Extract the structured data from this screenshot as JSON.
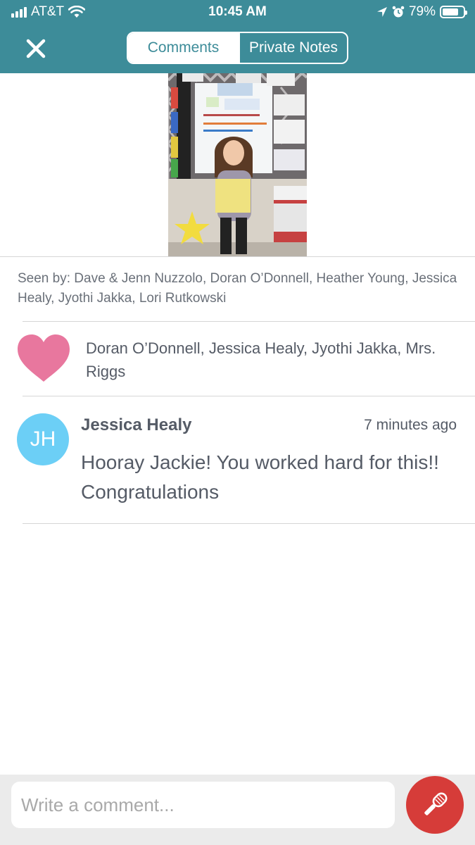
{
  "status_bar": {
    "carrier": "AT&T",
    "time": "10:45 AM",
    "battery": "79%",
    "battery_level": 0.79,
    "icons": [
      "signal-icon",
      "wifi-icon",
      "location-icon",
      "alarm-icon",
      "battery-icon"
    ]
  },
  "header": {
    "close_icon": "close-icon",
    "tabs": [
      {
        "label": "Comments",
        "active": true
      },
      {
        "label": "Private Notes",
        "active": false
      }
    ],
    "color": "#3d8c99"
  },
  "seen_by": "Seen by: Dave & Jenn Nuzzolo, Doran O’Donnell, Heather Young, Jessica Healy, Jyothi Jakka, Lori Rutkowski",
  "likes": {
    "icon": "heart-icon",
    "color": "#e8779e",
    "names": "Doran O’Donnell, Jessica Healy, Jyothi Jakka, Mrs. Riggs"
  },
  "comments": [
    {
      "initials": "JH",
      "author": "Jessica Healy",
      "time": "7 minutes ago",
      "text": "Hooray Jackie!  You worked hard for this!!  Congratulations",
      "avatar_color": "#6ccff6"
    }
  ],
  "composer": {
    "placeholder": "Write a comment...",
    "mic_icon": "microphone-icon",
    "mic_color": "#d63c39"
  }
}
